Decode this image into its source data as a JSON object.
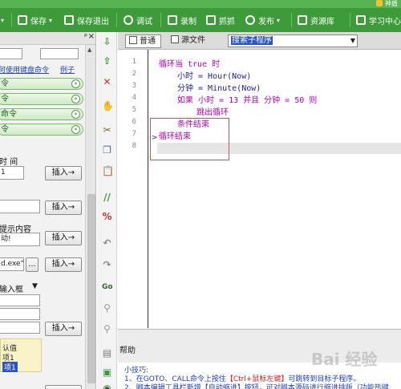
{
  "brand": "神盾",
  "toolbar": {
    "save": "保存",
    "save_exit": "保存退出",
    "debug": "调试",
    "record": "录制",
    "capture": "抓抓",
    "publish": "发布",
    "resources": "资源库",
    "learn": "学习中心"
  },
  "left": {
    "link_keyboard": "何使用键盘命令",
    "link_example": "例子",
    "cmd1": "令",
    "cmd2": "令",
    "cmd3": "命令",
    "cmd4": "令",
    "time_label": "时 间",
    "time_value": "1",
    "insert": "插入→",
    "prompt_line1": "提示内容",
    "prompt_line2": "动!",
    "file_value": "d.exe\"",
    "browse": "...",
    "input_box_label": "输入框",
    "opt_default": "认值",
    "opt_item1": "项1",
    "opt_item1_sel": "项1"
  },
  "tabs": {
    "normal": "普通",
    "source": "源文件",
    "sub_select": "搜索子程序"
  },
  "code": {
    "line_numbers": [
      "1",
      "2",
      "3",
      "4",
      "5",
      "6",
      "7",
      "8"
    ],
    "l1": "循环当 true 时",
    "l2": "小时 = Hour(Now)",
    "l3": "分钟 = Minute(Now)",
    "l4": "如果 小时 = 13 并且 分钟 = 50 则",
    "l5": "跳出循环",
    "l6": "条件结束",
    "l7": "循环结束"
  },
  "help": {
    "title": "帮助",
    "tip_title": "小技巧:",
    "tip1_a": "1、在GOTO、CALL命令上按住",
    "tip1_b": "【Ctrl+鼠标左键】",
    "tip1_c": "可跳转到目标子程序。",
    "tip2": "2、脚本编辑工具栏新增【自动缩进】按钮，可对脚本源码进行缩进排版（功能热键"
  },
  "watermark": "Bai 经验"
}
